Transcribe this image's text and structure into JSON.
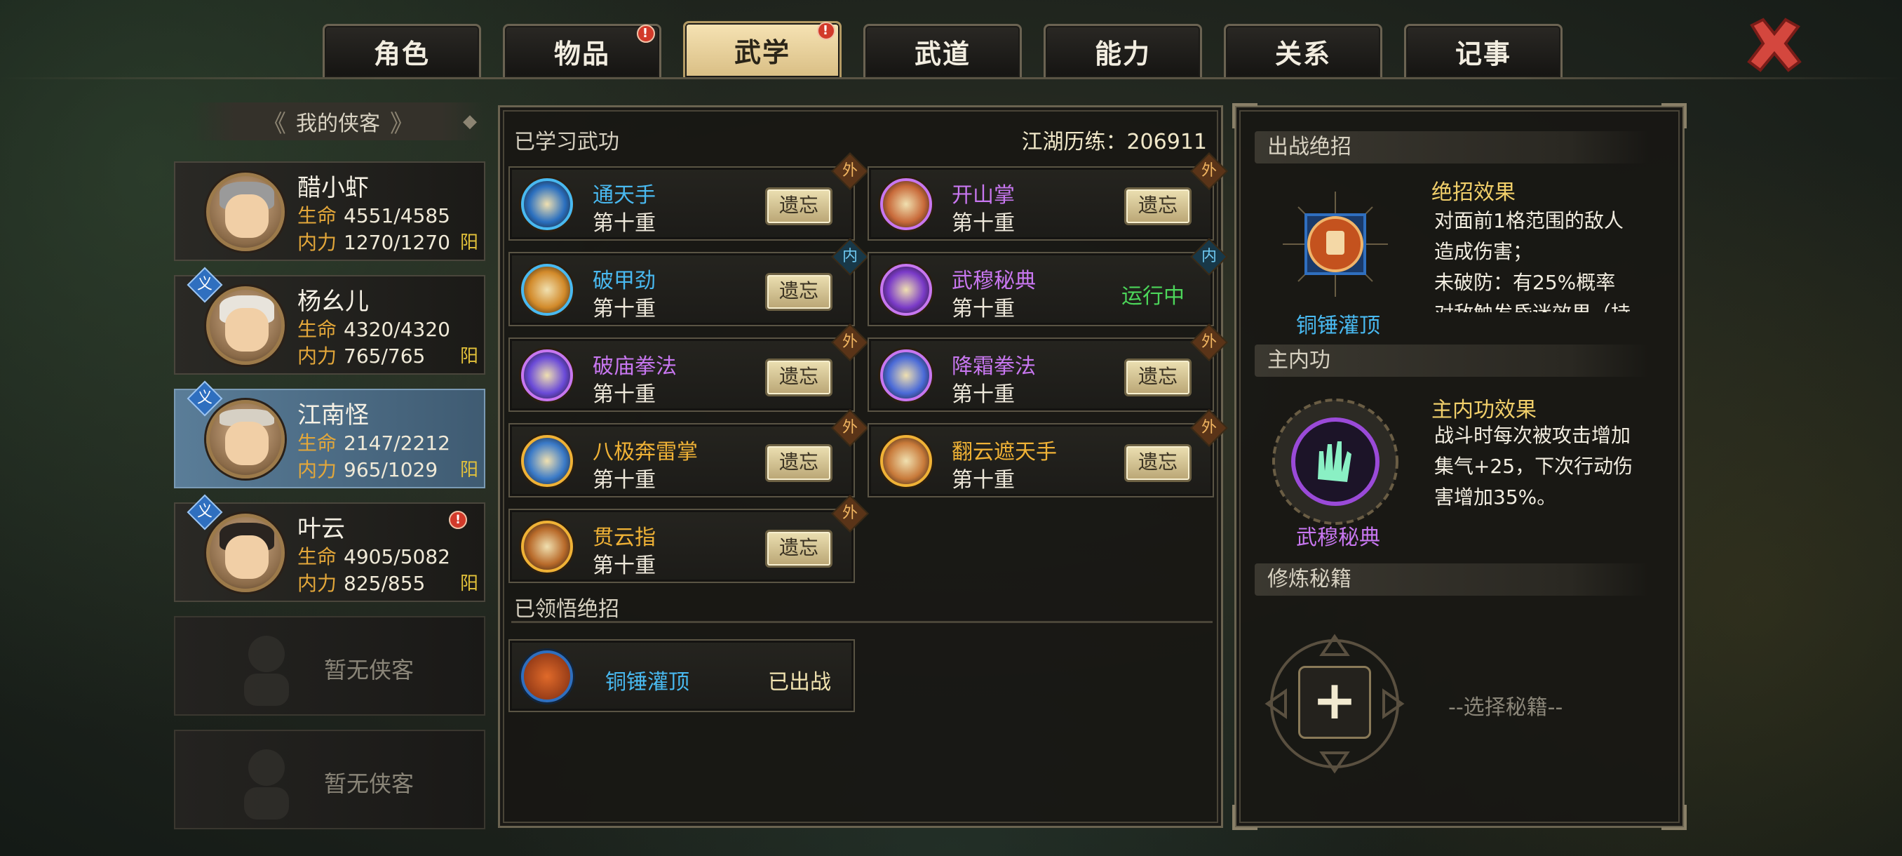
{
  "tabs": [
    {
      "label": "角色",
      "alert": false,
      "active": false
    },
    {
      "label": "物品",
      "alert": true,
      "active": false
    },
    {
      "label": "武学",
      "alert": true,
      "active": true
    },
    {
      "label": "武道",
      "alert": false,
      "active": false
    },
    {
      "label": "能力",
      "alert": false,
      "active": false
    },
    {
      "label": "关系",
      "alert": false,
      "active": false
    },
    {
      "label": "记事",
      "alert": false,
      "active": false
    }
  ],
  "alert_mark": "!",
  "roster": {
    "title": "我的侠客",
    "characters": [
      {
        "name": "醋小虾",
        "hp_label": "生命",
        "hp": "4551/4585",
        "mp_label": "内力",
        "mp": "1270/1270",
        "affinity": "阳",
        "badge": ""
      },
      {
        "name": "杨幺儿",
        "hp_label": "生命",
        "hp": "4320/4320",
        "mp_label": "内力",
        "mp": "765/765",
        "affinity": "阳",
        "badge": "义"
      },
      {
        "name": "江南怪",
        "hp_label": "生命",
        "hp": "2147/2212",
        "mp_label": "内力",
        "mp": "965/1029",
        "affinity": "阳",
        "badge": "义"
      },
      {
        "name": "叶云",
        "hp_label": "生命",
        "hp": "4905/5082",
        "mp_label": "内力",
        "mp": "825/855",
        "affinity": "阳",
        "badge": "义"
      }
    ],
    "empty_label": "暂无侠客"
  },
  "learned": {
    "title": "已学习武功",
    "experience": "江湖历练：206911",
    "forget_label": "遗忘",
    "level_label": "第十重",
    "skills": [
      {
        "name": "通天手",
        "color": "#49b9f0",
        "type": "外",
        "status": "遗忘"
      },
      {
        "name": "开山掌",
        "color": "#c877f0",
        "type": "外",
        "status": "遗忘"
      },
      {
        "name": "破甲劲",
        "color": "#49b9f0",
        "type": "内",
        "status": "遗忘"
      },
      {
        "name": "武穆秘典",
        "color": "#c877f0",
        "type": "内",
        "status": "运行中"
      },
      {
        "name": "破庙拳法",
        "color": "#c877f0",
        "type": "外",
        "status": "遗忘"
      },
      {
        "name": "降霜拳法",
        "color": "#c877f0",
        "type": "外",
        "status": "遗忘"
      },
      {
        "name": "八极奔雷掌",
        "color": "#f0b236",
        "type": "外",
        "status": "遗忘"
      },
      {
        "name": "翻云遮天手",
        "color": "#f0b236",
        "type": "外",
        "status": "遗忘"
      },
      {
        "name": "贯云指",
        "color": "#f0b236",
        "type": "外",
        "status": "遗忘"
      }
    ]
  },
  "ultimate": {
    "title": "已领悟绝招",
    "name": "铜锤灌顶",
    "status": "已出战"
  },
  "right": {
    "battle_title": "出战绝招",
    "battle_effect_title": "绝招效果",
    "battle_effect_lines": [
      "对面前1格范围的敌人",
      "造成伤害；",
      "未破防：有25%概率",
      "对敌触发昏迷效果（持"
    ],
    "battle_skill_name": "铜锤灌顶",
    "main_title": "主内功",
    "main_effect_title": "主内功效果",
    "main_effect_lines": [
      "战斗时每次被攻击增加",
      "集气+25，下次行动伤",
      "害增加35%。"
    ],
    "main_skill_name": "武穆秘典",
    "book_title": "修炼秘籍",
    "book_add": "+",
    "book_pick": "--选择秘籍--"
  }
}
